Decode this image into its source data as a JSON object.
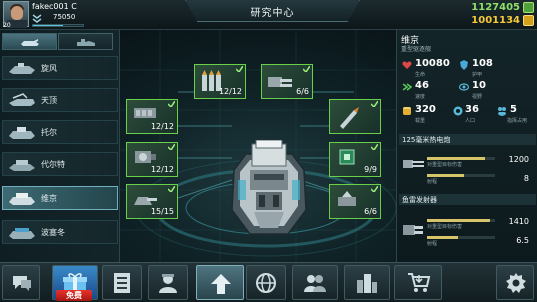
{
  "header": {
    "player_name": "fakec001 C",
    "level": "20",
    "xp_value": "75050",
    "xp_progress": 0.6,
    "screen_title": "研究中心",
    "resource_green": "1127405",
    "resource_gold": "1001134"
  },
  "left_tabs": [
    {
      "icon": "tank-tab-icon",
      "active": true
    },
    {
      "icon": "base-tab-icon",
      "active": false
    }
  ],
  "units": [
    {
      "label": "旋风",
      "selected": false
    },
    {
      "label": "天顶",
      "selected": false
    },
    {
      "label": "托尔",
      "selected": false
    },
    {
      "label": "代尔特",
      "selected": false
    },
    {
      "label": "维京",
      "selected": true
    },
    {
      "label": "波塞冬",
      "selected": false
    }
  ],
  "slots": [
    {
      "id": "slot-top-left",
      "count": "12/12",
      "icon": "ammo-shells-icon"
    },
    {
      "id": "slot-top-right",
      "count": "6/6",
      "icon": "cannon-icon"
    },
    {
      "id": "slot-mid-left-1",
      "count": "12/12",
      "icon": "armor-plate-icon"
    },
    {
      "id": "slot-mid-right-1",
      "count": "",
      "icon": "missile-icon"
    },
    {
      "id": "slot-mid-left-2",
      "count": "12/12",
      "icon": "engine-icon"
    },
    {
      "id": "slot-mid-right-2",
      "count": "9/9",
      "icon": "chip-icon"
    },
    {
      "id": "slot-bot-left",
      "count": "15/15",
      "icon": "turret-icon"
    },
    {
      "id": "slot-bot-right",
      "count": "6/6",
      "icon": "radar-icon"
    }
  ],
  "unit_detail": {
    "name": "维京",
    "type": "重型驱逐舰",
    "stats": [
      {
        "icon": "heart-icon",
        "value": "10080",
        "label": "生命",
        "color": "#e04848"
      },
      {
        "icon": "armor-icon",
        "value": "108",
        "label": "护甲",
        "color": "#4aa8d8"
      },
      {
        "icon": "speed-icon",
        "value": "46",
        "label": "速度",
        "color": "#58c858"
      },
      {
        "icon": "eye-icon",
        "value": "10",
        "label": "视野",
        "color": "#58b8d8"
      },
      {
        "icon": "cargo-icon",
        "value": "320",
        "label": "载重",
        "color": "#e0b030"
      },
      {
        "icon": "pop-icon",
        "value": "36",
        "label": "人口",
        "color": "#58b8d8"
      },
      {
        "icon": "people-icon",
        "value": "5",
        "label": "指挥占用",
        "color": "#58b8d8"
      }
    ],
    "weapons": [
      {
        "name": "125毫米热电炮",
        "stat_a_label": "对重型目标伤害",
        "stat_a_value": "1200",
        "stat_a_fraction": 0.85,
        "stat_b_label": "射程",
        "stat_b_value": "8",
        "stat_b_fraction": 0.55
      },
      {
        "name": "鱼雷发射器",
        "stat_a_label": "对重型目标伤害",
        "stat_a_value": "1410",
        "stat_a_fraction": 0.92,
        "stat_b_label": "射程",
        "stat_b_value": "6.5",
        "stat_b_fraction": 0.45
      }
    ]
  },
  "bottom_nav": [
    {
      "icon": "chat-icon"
    },
    {
      "icon": "gift-box-icon",
      "badge": "免费"
    },
    {
      "icon": "list-icon"
    },
    {
      "icon": "commander-icon"
    },
    {
      "icon": "upgrade-arrow-icon"
    },
    {
      "icon": "globe-icon"
    },
    {
      "icon": "alliance-icon"
    },
    {
      "icon": "city-icon"
    },
    {
      "icon": "shop-cart-icon"
    },
    {
      "icon": "settings-gear-icon"
    }
  ],
  "colors": {
    "accent_green": "#6ad04a",
    "accent_cyan": "#59c3d8",
    "resource_gold": "#f4c93a",
    "badge_red": "#e6322a"
  }
}
